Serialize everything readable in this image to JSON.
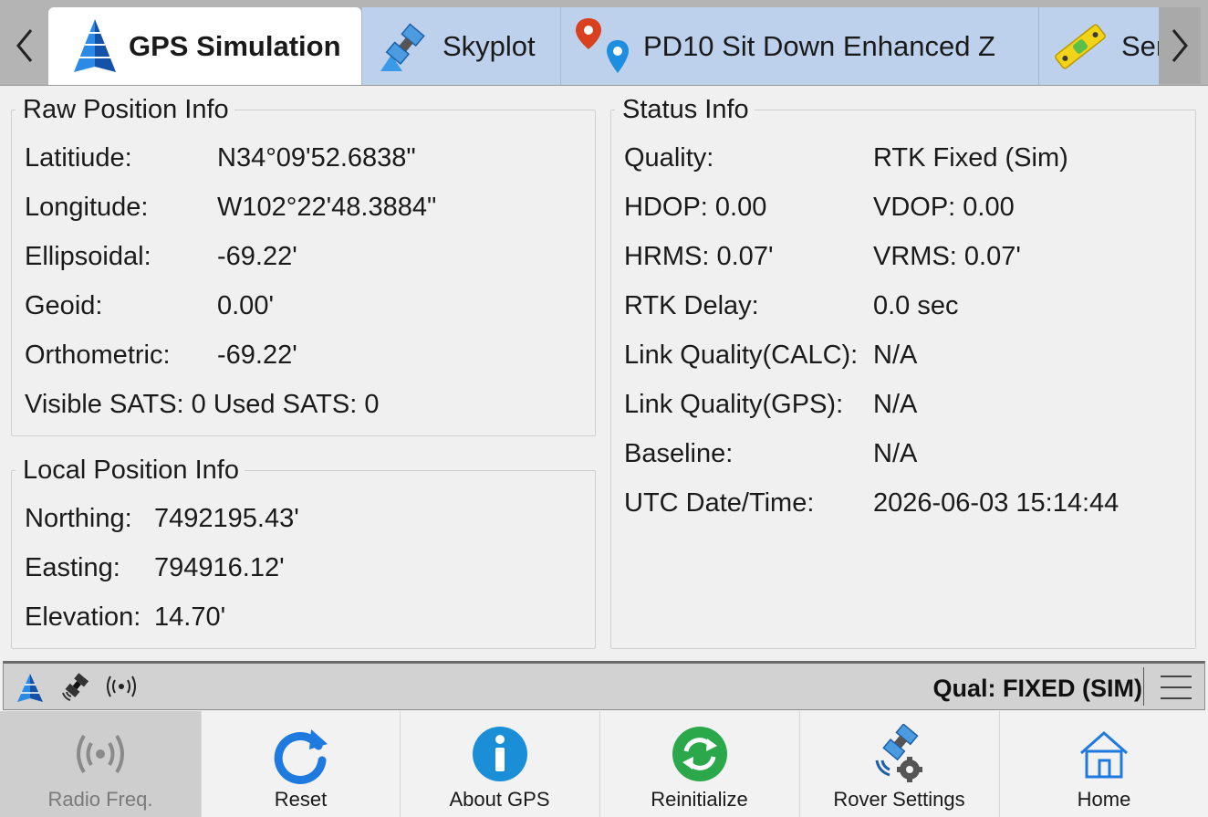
{
  "tabs": [
    {
      "label": "GPS Simulation",
      "icon": "pyramid-icon",
      "active": true
    },
    {
      "label": "Skyplot",
      "icon": "satellite-icon",
      "active": false
    },
    {
      "label": "PD10 Sit Down Enhanced Z",
      "icon": "location-pins-icon",
      "active": false
    },
    {
      "label": "Ser",
      "icon": "level-tool-icon",
      "active": false
    }
  ],
  "raw_position": {
    "title": "Raw Position Info",
    "latitude_label": "Latitiude:",
    "latitude_value": "N34°09'52.6838\"",
    "longitude_label": "Longitude:",
    "longitude_value": "W102°22'48.3884\"",
    "ellipsoidal_label": "Ellipsoidal:",
    "ellipsoidal_value": "-69.22'",
    "geoid_label": "Geoid:",
    "geoid_value": "0.00'",
    "orthometric_label": "Orthometric:",
    "orthometric_value": "-69.22'",
    "sats_line": "Visible SATS: 0 Used SATS: 0"
  },
  "local_position": {
    "title": "Local Position Info",
    "northing_label": "Northing:",
    "northing_value": "7492195.43'",
    "easting_label": "Easting:",
    "easting_value": "794916.12'",
    "elevation_label": "Elevation:",
    "elevation_value": "14.70'"
  },
  "status": {
    "title": "Status Info",
    "quality_label": "Quality:",
    "quality_value": "RTK Fixed (Sim)",
    "hdop": "HDOP: 0.00",
    "vdop": "VDOP: 0.00",
    "hrms": "HRMS: 0.07'",
    "vrms": "VRMS: 0.07'",
    "rtk_delay_label": "RTK Delay:",
    "rtk_delay_value": "0.0 sec",
    "link_calc_label": "Link Quality(CALC):",
    "link_calc_value": "N/A",
    "link_gps_label": "Link Quality(GPS):",
    "link_gps_value": "N/A",
    "baseline_label": "Baseline:",
    "baseline_value": "N/A",
    "utc_label": "UTC Date/Time:",
    "utc_value": "2026-06-03 15:14:44"
  },
  "status_bar": {
    "qual_text": "Qual: FIXED (SIM)",
    "icons": [
      "pyramid-icon",
      "satellite-icon",
      "radio-signal-icon"
    ]
  },
  "toolbar": [
    {
      "label": "Radio Freq.",
      "icon": "radio-waves-icon",
      "enabled": false
    },
    {
      "label": "Reset",
      "icon": "reset-icon",
      "enabled": true
    },
    {
      "label": "About GPS",
      "icon": "info-icon",
      "enabled": true
    },
    {
      "label": "Reinitialize",
      "icon": "reinitialize-icon",
      "enabled": true
    },
    {
      "label": "Rover Settings",
      "icon": "rover-satellite-icon",
      "enabled": true
    },
    {
      "label": "Home",
      "icon": "home-icon",
      "enabled": true
    }
  ],
  "colors": {
    "tab_active": "#ffffff",
    "tab_inactive": "#bdd0ec",
    "pyramid_blue": "#1e6fc9",
    "reset_blue": "#1f7ae0",
    "info_blue": "#1a8fd8",
    "reinit_green": "#2aa84a",
    "location_red": "#d9411e"
  }
}
